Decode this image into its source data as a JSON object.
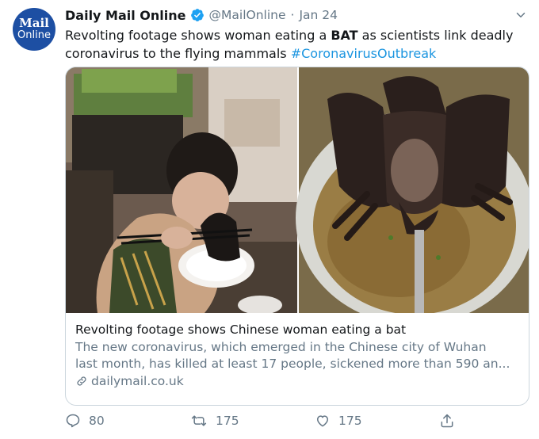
{
  "author": {
    "avatar_line1": "Mail",
    "avatar_line2": "Online",
    "name": "Daily Mail Online",
    "handle": "@MailOnline",
    "separator": "·",
    "date": "Jan 24"
  },
  "tweet": {
    "text_part1": "Revolting footage shows woman eating a ",
    "text_bold": "BAT",
    "text_part2": " as scientists link deadly coronavirus to the flying mammals ",
    "hashtag": "#CoronavirusOutbreak"
  },
  "card": {
    "title": "Revolting footage shows Chinese woman eating a bat",
    "description_line1": "The new coronavirus, which emerged in the Chinese city of Wuhan",
    "description_line2": "last month, has killed at least 17 people, sickened more than 590 an...",
    "link": "dailymail.co.uk"
  },
  "actions": {
    "reply_count": "80",
    "retweet_count": "175",
    "like_count": "175"
  },
  "colors": {
    "brand_blue": "#1d4fa3",
    "hashtag_blue": "#1b95e0",
    "muted_gray": "#657786",
    "verified_blue": "#1da1f2"
  },
  "icons": [
    "verified-badge-icon",
    "chevron-down-icon",
    "link-icon",
    "reply-icon",
    "retweet-icon",
    "like-icon",
    "share-icon"
  ]
}
